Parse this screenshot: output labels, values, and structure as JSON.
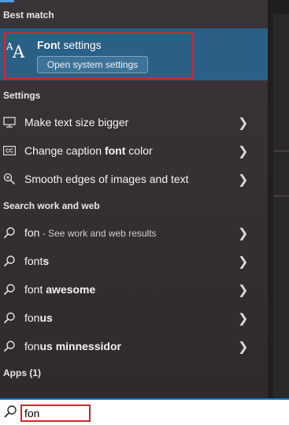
{
  "best_match": {
    "heading": "Best match",
    "title_bold": "Fon",
    "title_rest": "t settings",
    "button_label": "Open system settings"
  },
  "settings": {
    "heading": "Settings",
    "items": [
      {
        "pre": "Make text size bigger",
        "bold": "",
        "post": "",
        "icon": "monitor-icon"
      },
      {
        "pre": "Change caption ",
        "bold": "font",
        "post": " color",
        "icon": "caption-cc-icon"
      },
      {
        "pre": "Smooth edges of images and text",
        "bold": "",
        "post": "",
        "icon": "zoom-icon"
      }
    ]
  },
  "web": {
    "heading": "Search work and web",
    "items": [
      {
        "pre": "fon",
        "bold": "",
        "sub": " - See work and web results"
      },
      {
        "pre": "font",
        "bold": "s",
        "sub": ""
      },
      {
        "pre": "font ",
        "bold": "awesome",
        "sub": ""
      },
      {
        "pre": "fon",
        "bold": "us",
        "sub": ""
      },
      {
        "pre": "fon",
        "bold": "us minnessidor",
        "sub": ""
      }
    ]
  },
  "apps": {
    "heading": "Apps (1)"
  },
  "search": {
    "value": "fon",
    "icon": "search-icon"
  },
  "colors": {
    "accent": "#0078d4",
    "best_match_bg": "#2a5f86",
    "highlight": "#e0202a"
  }
}
